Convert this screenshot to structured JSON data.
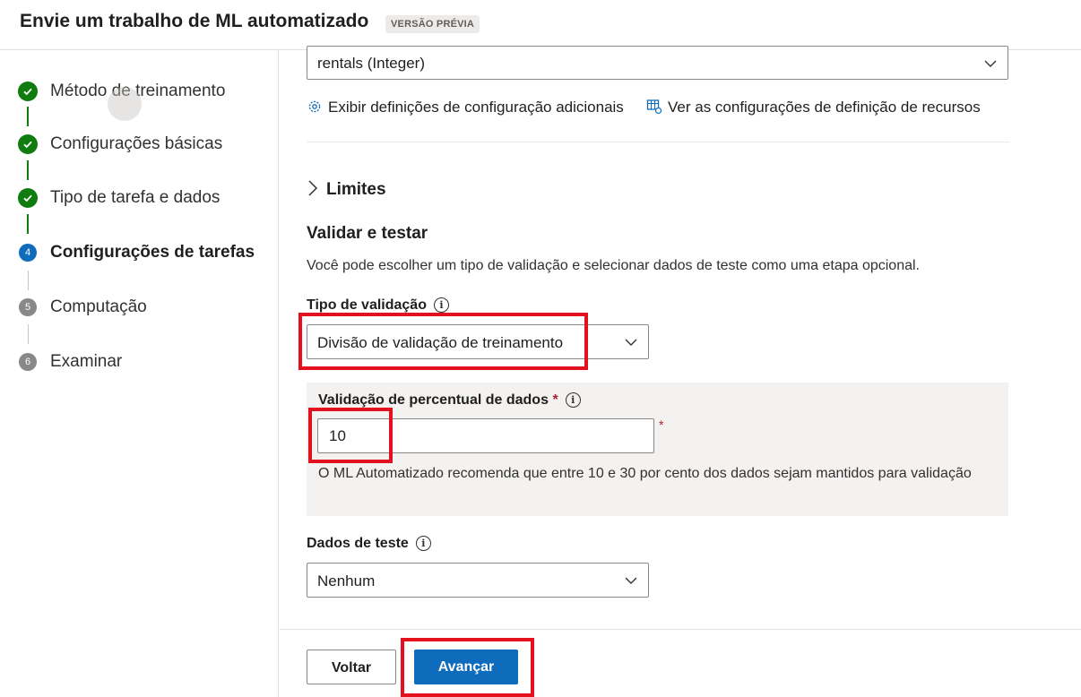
{
  "header": {
    "title": "Envie um trabalho de ML automatizado",
    "badge": "VERSÃO PRÉVIA"
  },
  "steps": [
    {
      "number": "1",
      "label": "Método de treinamento",
      "status": "completed"
    },
    {
      "number": "2",
      "label": "Configurações básicas",
      "status": "completed"
    },
    {
      "number": "3",
      "label": "Tipo de tarefa e dados",
      "status": "completed"
    },
    {
      "number": "4",
      "label": "Configurações de tarefas",
      "status": "current"
    },
    {
      "number": "5",
      "label": "Computação",
      "status": "pending"
    },
    {
      "number": "6",
      "label": "Examinar",
      "status": "pending"
    }
  ],
  "main": {
    "target_column_value": "rentals (Integer)",
    "links": {
      "additional_config": "Exibir definições de configuração adicionais",
      "featurization": "Ver as configurações de definição de recursos"
    },
    "limits_label": "Limites",
    "section_title": "Validar e testar",
    "section_description": "Você pode escolher um tipo de validação e selecionar dados de teste como uma etapa opcional.",
    "validation_type": {
      "label": "Tipo de validação",
      "value": "Divisão de validação de treinamento"
    },
    "percent": {
      "label": "Validação de percentual de dados",
      "required_mark": "*",
      "value": "10",
      "help": "O ML Automatizado recomenda que entre 10 e 30 por cento dos dados sejam mantidos para validação"
    },
    "test_data": {
      "label": "Dados de teste",
      "value": "Nenhum"
    },
    "info_glyph": "i"
  },
  "footer": {
    "back_label": "Voltar",
    "next_label": "Avançar"
  },
  "colors": {
    "accent": "#0f6cbd",
    "success": "#107c10",
    "highlight": "#e3101e"
  }
}
